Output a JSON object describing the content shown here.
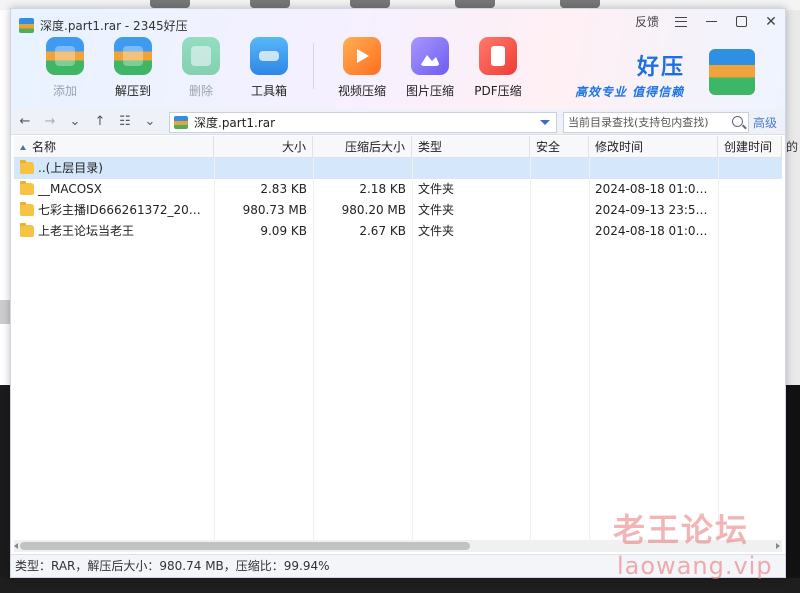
{
  "window": {
    "title": "深度.part1.rar - 2345好压",
    "feedback_label": "反馈"
  },
  "toolbar": {
    "buttons": [
      {
        "label": "添加",
        "icon": "archive-add-icon",
        "enabled": false
      },
      {
        "label": "解压到",
        "icon": "extract-icon",
        "enabled": true
      },
      {
        "label": "删除",
        "icon": "recycle-delete-icon",
        "enabled": false
      },
      {
        "label": "工具箱",
        "icon": "toolbox-icon",
        "enabled": true
      }
    ],
    "tools": [
      {
        "label": "视频压缩",
        "icon": "video-compress-icon"
      },
      {
        "label": "图片压缩",
        "icon": "image-compress-icon"
      },
      {
        "label": "PDF压缩",
        "icon": "pdf-compress-icon"
      }
    ]
  },
  "brand": {
    "title": "好压",
    "slogan": "高效专业  值得信赖",
    "colors": {
      "primary": "#1e6fe0"
    }
  },
  "nav": {
    "path": "深度.part1.rar",
    "search_placeholder": "当前目录查找(支持包内查找)",
    "advanced_label": "高级"
  },
  "table": {
    "columns": {
      "name": "名称",
      "size": "大小",
      "compressed": "压缩后大小",
      "type": "类型",
      "security": "安全",
      "modified": "修改时间",
      "created": "创建时间"
    },
    "rows": [
      {
        "name": "..(上层目录)",
        "size": "",
        "compressed": "",
        "type": "",
        "security": "",
        "modified": "",
        "created": "",
        "selected": true
      },
      {
        "name": "__MACOSX",
        "size": "2.83 KB",
        "compressed": "2.18 KB",
        "type": "文件夹",
        "security": "",
        "modified": "2024-08-18 01:05:...",
        "created": ""
      },
      {
        "name": "七彩主播ID666261372_20240...",
        "size": "980.73 MB",
        "compressed": "980.20 MB",
        "type": "文件夹",
        "security": "",
        "modified": "2024-09-13 23:51:...",
        "created": ""
      },
      {
        "name": "上老王论坛当老王",
        "size": "9.09 KB",
        "compressed": "2.67 KB",
        "type": "文件夹",
        "security": "",
        "modified": "2024-08-18 01:05:...",
        "created": ""
      }
    ]
  },
  "status": {
    "text": "类型：RAR，解压后大小：980.74 MB，压缩比：99.94%"
  },
  "watermark": {
    "line1": "老王论坛",
    "line2": "laowang.vip"
  },
  "stray_text": "的"
}
